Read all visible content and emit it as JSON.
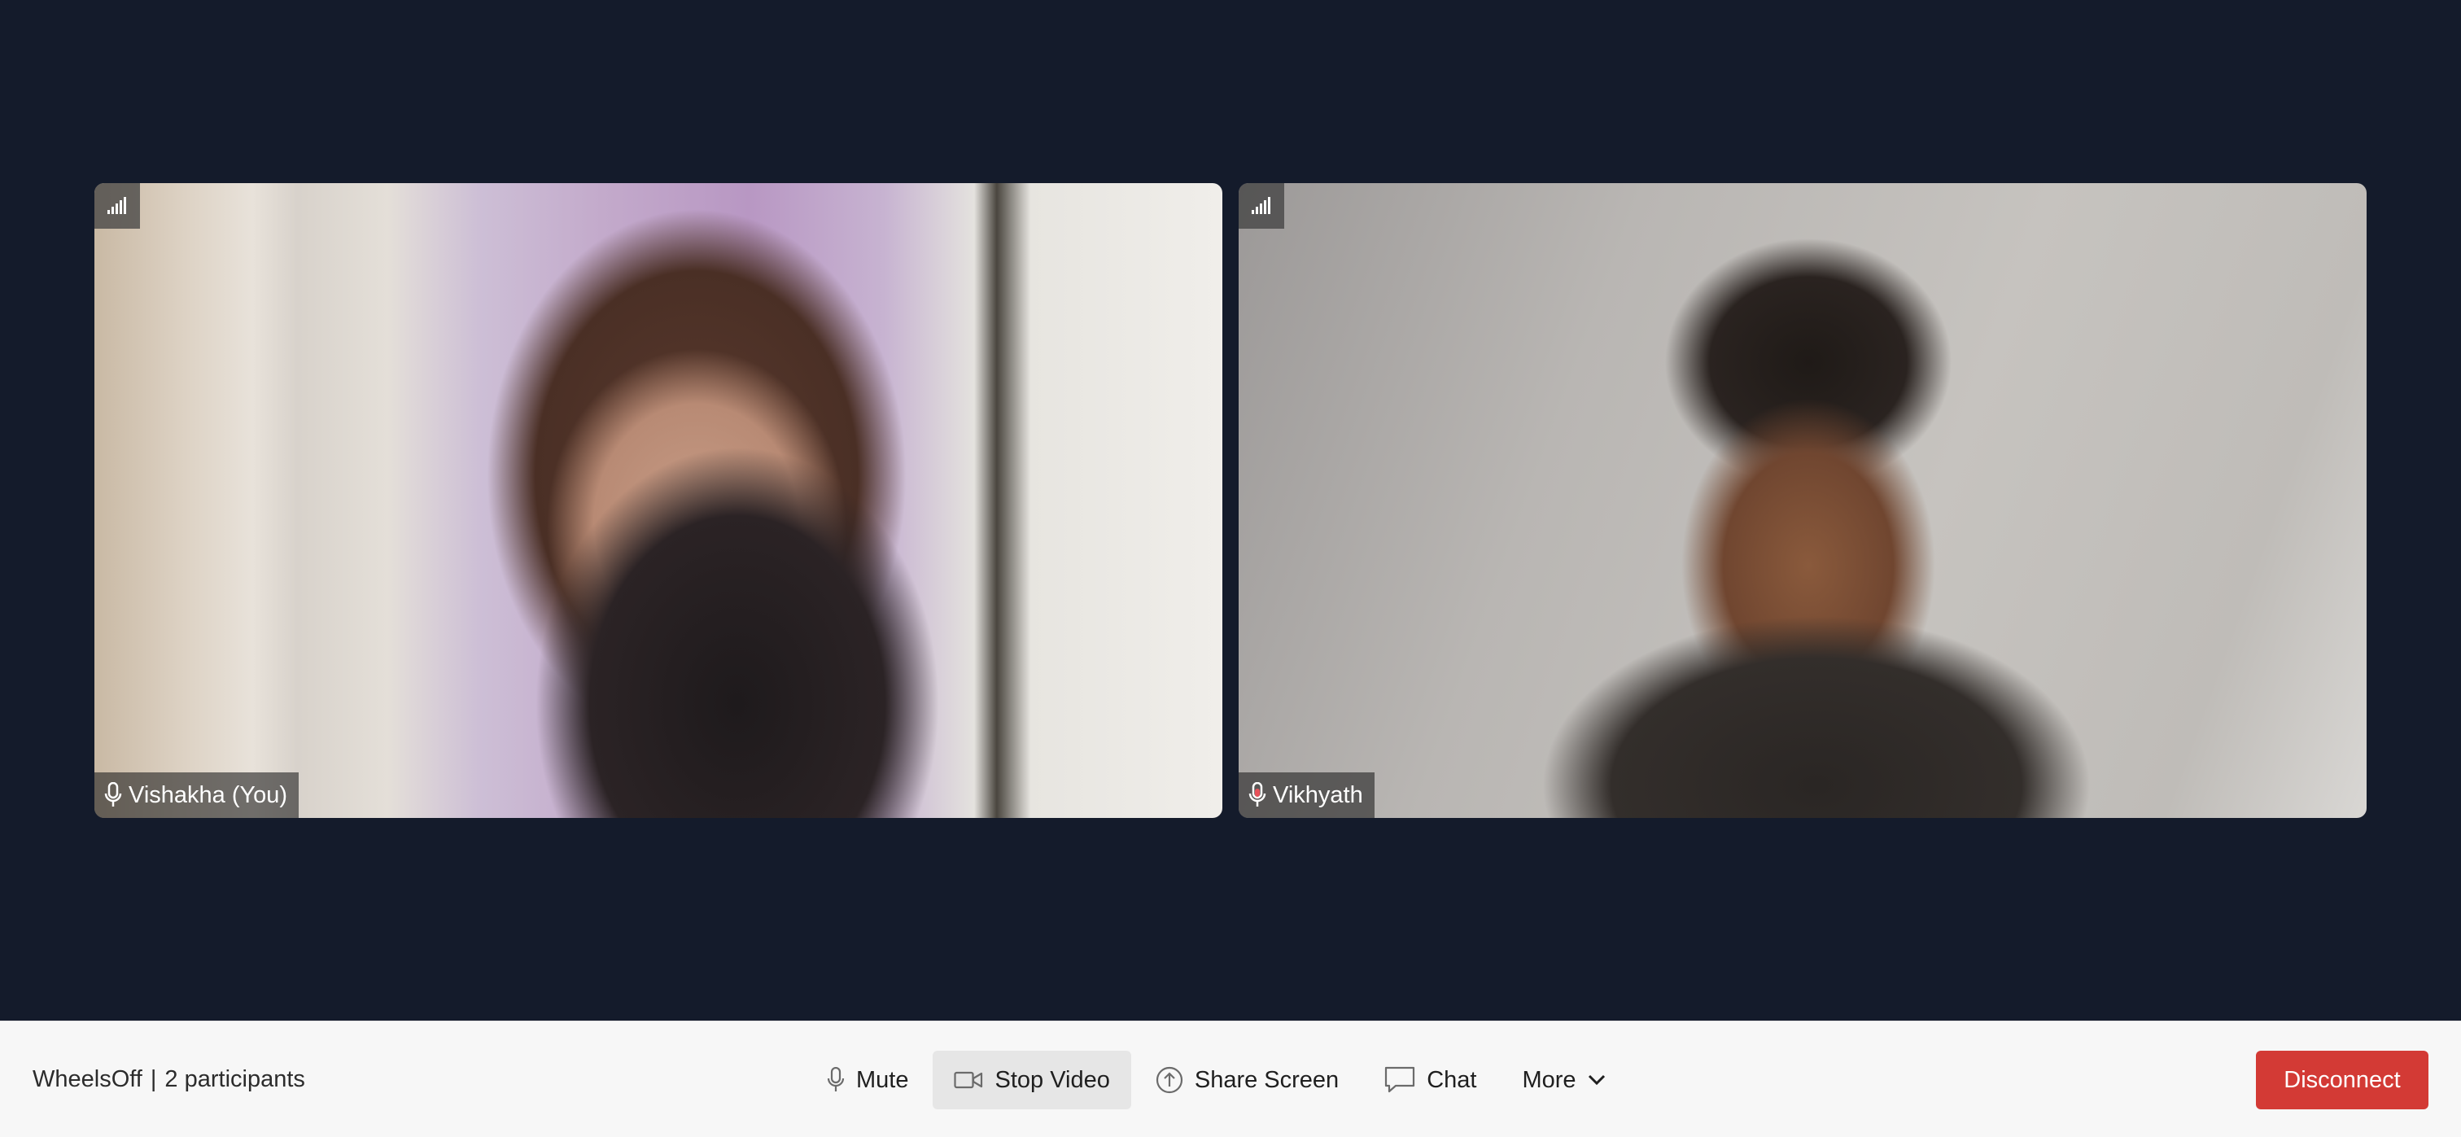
{
  "meeting": {
    "room_name": "WheelsOff",
    "separator": "|",
    "participants_text": "2 participants"
  },
  "participants": [
    {
      "name": "Vishakha (You)",
      "mic_icon": "mic-icon",
      "signal_icon": "signal-bars-icon"
    },
    {
      "name": "Vikhyath",
      "mic_icon": "mic-icon",
      "signal_icon": "signal-bars-icon"
    }
  ],
  "controls": {
    "mute_label": "Mute",
    "stop_video_label": "Stop Video",
    "share_screen_label": "Share Screen",
    "chat_label": "Chat",
    "more_label": "More",
    "disconnect_label": "Disconnect"
  },
  "colors": {
    "stage_background": "#141b2b",
    "toolbar_background": "#f7f7f7",
    "disconnect": "#d33a35",
    "speaking_mic": "#e8525a"
  }
}
